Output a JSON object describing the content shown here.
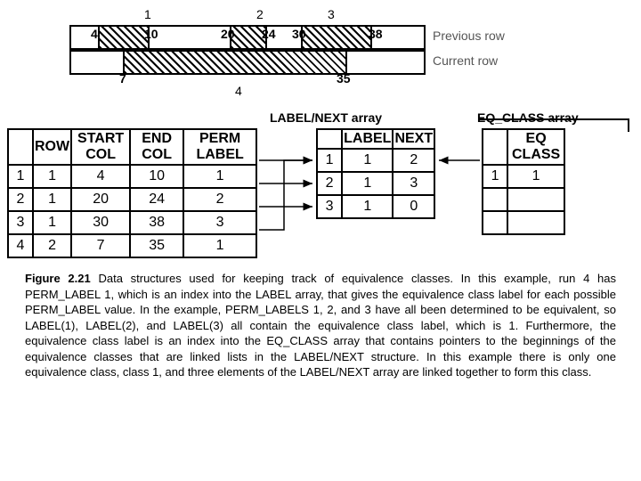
{
  "diagram": {
    "top_labels": [
      "1",
      "2",
      "3"
    ],
    "prev_segments": [
      {
        "start": "4",
        "end": "10"
      },
      {
        "start": "20",
        "end": "24"
      },
      {
        "start": "30",
        "end": "38"
      }
    ],
    "curr_segment": {
      "start": "7",
      "end": "35"
    },
    "bottom_label": "4",
    "row_prev": "Previous row",
    "row_curr": "Current row"
  },
  "headings": {
    "label_next": "LABEL/NEXT array",
    "eq_class": "EQ_CLASS array"
  },
  "runs_table": {
    "headers": [
      "ROW",
      "START COL",
      "END COL",
      "PERM LABEL"
    ],
    "rows": [
      {
        "idx": "1",
        "row": "1",
        "start": "4",
        "end": "10",
        "perm": "1"
      },
      {
        "idx": "2",
        "row": "1",
        "start": "20",
        "end": "24",
        "perm": "2"
      },
      {
        "idx": "3",
        "row": "1",
        "start": "30",
        "end": "38",
        "perm": "3"
      },
      {
        "idx": "4",
        "row": "2",
        "start": "7",
        "end": "35",
        "perm": "1"
      }
    ]
  },
  "label_next_table": {
    "headers": [
      "LABEL",
      "NEXT"
    ],
    "rows": [
      {
        "idx": "1",
        "label": "1",
        "next": "2"
      },
      {
        "idx": "2",
        "label": "1",
        "next": "3"
      },
      {
        "idx": "3",
        "label": "1",
        "next": "0"
      }
    ]
  },
  "eq_class_table": {
    "header": "EQ CLASS",
    "rows": [
      {
        "idx": "1",
        "val": "1"
      },
      {
        "idx": "",
        "val": ""
      },
      {
        "idx": "",
        "val": ""
      }
    ]
  },
  "caption": {
    "bold": "Figure 2.21",
    "text": " Data structures used for keeping track of equivalence classes. In this example, run 4 has PERM_LABEL 1, which is an index into the LABEL array, that gives the equivalence class label for each possible PERM_LABEL value. In the example, PERM_LABELS 1, 2, and 3 have all been determined to be equivalent, so LABEL(1), LABEL(2), and LABEL(3) all contain the equivalence class label, which is 1. Furthermore, the equivalence class label is an index into the EQ_CLASS array that contains pointers to the beginnings of the equivalence classes that are linked lists in the LABEL/NEXT structure. In this example there is only one equivalence class, class 1, and three elements of the LABEL/NEXT array are linked together to form this class."
  }
}
